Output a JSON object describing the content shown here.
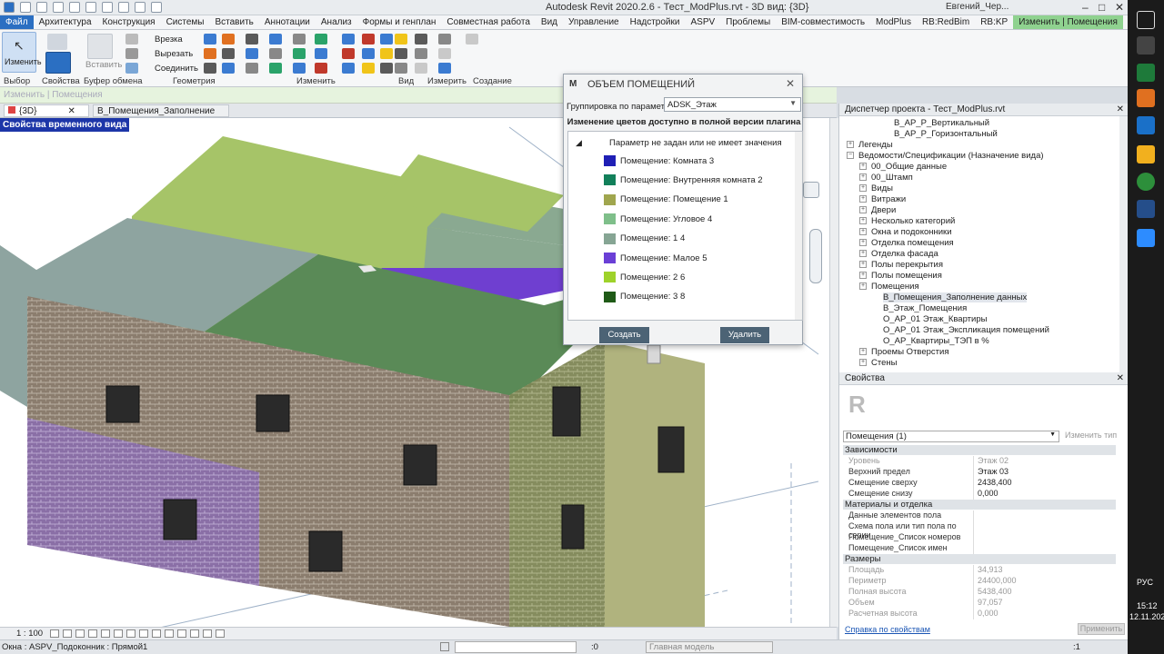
{
  "title": "Autodesk Revit 2020.2.6 - Тест_ModPlus.rvt - 3D вид: {3D}",
  "user": "Евгений_Чер...",
  "menu": [
    "Файл",
    "Архитектура",
    "Конструкция",
    "Системы",
    "Вставить",
    "Аннотации",
    "Анализ",
    "Формы и генплан",
    "Совместная работа",
    "Вид",
    "Управление",
    "Надстройки",
    "ASPV",
    "Проблемы",
    "BIM-совместимость",
    "ModPlus",
    "RB:RedBim",
    "RB:KP",
    "Изменить | Помещения"
  ],
  "ribbon": {
    "modify": "Изменить",
    "paste": "Вставить",
    "cut": "Врезка",
    "cut2": "Вырезать",
    "join": "Соединить",
    "groups": [
      "Выбор",
      "Свойства",
      "Буфер обмена",
      "Геометрия",
      "Изменить",
      "Вид",
      "Измерить",
      "Создание"
    ]
  },
  "context_line": "Изменить | Помещения",
  "view_tabs": [
    "{3D}",
    "В_Помещения_Заполнение данных"
  ],
  "viewport_label": "Свойства временного вида",
  "status": {
    "scale": "1 : 100",
    "hint": "Окна : ASPV_Подоконник : Прямой1",
    "count": ":0",
    "model": "Главная модель",
    "filter": ":1"
  },
  "dialog": {
    "title": "ОБЪЕМ ПОМЕЩЕНИЙ",
    "group_label": "Группировка по параметру:",
    "group_value": "ADSK_Этаж",
    "note": "Изменение цветов доступно в полной версии плагина",
    "tree_root": "Параметр не задан или не имеет значения",
    "items": [
      {
        "label": "Помещение: Комната 3",
        "color": "#1f1fb5"
      },
      {
        "label": "Помещение: Внутренняя комната 2",
        "color": "#12805a"
      },
      {
        "label": "Помещение: Помещение 1",
        "color": "#a0a64e"
      },
      {
        "label": "Помещение: Угловое 4",
        "color": "#7fbf8a"
      },
      {
        "label": "Помещение: 1 4",
        "color": "#86a594"
      },
      {
        "label": "Помещение: Малое 5",
        "color": "#6a3fd6"
      },
      {
        "label": "Помещение: 2 6",
        "color": "#9ed22a"
      },
      {
        "label": "Помещение: 3 8",
        "color": "#1f5a17"
      }
    ],
    "create": "Создать",
    "delete": "Удалить"
  },
  "browser": {
    "title": "Диспетчер проекта - Тест_ModPlus.rvt",
    "nodes": [
      {
        "label": "В_АР_Р_Вертикальный",
        "level": 3
      },
      {
        "label": "В_АР_Р_Горизонтальный",
        "level": 3
      },
      {
        "label": "Легенды",
        "level": 0
      },
      {
        "label": "Ведомости/Спецификации (Назначение вида)",
        "level": 0
      },
      {
        "label": "00_Общие данные",
        "level": 1
      },
      {
        "label": "00_Штамп",
        "level": 1
      },
      {
        "label": "Виды",
        "level": 1
      },
      {
        "label": "Витражи",
        "level": 1
      },
      {
        "label": "Двери",
        "level": 1
      },
      {
        "label": "Несколько категорий",
        "level": 1
      },
      {
        "label": "Окна и подоконники",
        "level": 1
      },
      {
        "label": "Отделка помещения",
        "level": 1
      },
      {
        "label": "Отделка фасада",
        "level": 1
      },
      {
        "label": "Полы перекрытия",
        "level": 1
      },
      {
        "label": "Полы помещения",
        "level": 1
      },
      {
        "label": "Помещения",
        "level": 1
      },
      {
        "label": "В_Помещения_Заполнение данных",
        "level": 2
      },
      {
        "label": "В_Этаж_Помещения",
        "level": 2
      },
      {
        "label": "О_АР_01 Этаж_Квартиры",
        "level": 2
      },
      {
        "label": "О_АР_01 Этаж_Экспликация помещений",
        "level": 2
      },
      {
        "label": "О_АР_Квартиры_ТЭП в %",
        "level": 2
      },
      {
        "label": "Проемы Отверстия",
        "level": 1
      },
      {
        "label": "Стены",
        "level": 1
      }
    ]
  },
  "props": {
    "title": "Свойства",
    "type_selector": "Помещения (1)",
    "edit_type": "Изменить тип",
    "sections": [
      "Зависимости",
      "Материалы и отделка",
      "Размеры"
    ],
    "rows1": [
      {
        "n": "Уровень",
        "v": "Этаж 02",
        "grey": true
      },
      {
        "n": "Верхний предел",
        "v": "Этаж 03",
        "grey": false
      },
      {
        "n": "Смещение сверху",
        "v": "2438,400",
        "grey": false
      },
      {
        "n": "Смещение снизу",
        "v": "0,000",
        "grey": false
      }
    ],
    "rows2": [
      {
        "n": "Данные элементов пола",
        "v": "",
        "grey": false
      },
      {
        "n": "Схема пола или тип пола по серии",
        "v": "",
        "grey": false
      },
      {
        "n": "Помещение_Список номеров",
        "v": "",
        "grey": false
      },
      {
        "n": "Помещение_Список имен",
        "v": "",
        "grey": false
      }
    ],
    "rows3": [
      {
        "n": "Площадь",
        "v": "34,913",
        "grey": true
      },
      {
        "n": "Периметр",
        "v": "24400,000",
        "grey": true
      },
      {
        "n": "Полная высота",
        "v": "5438,400",
        "grey": true
      },
      {
        "n": "Объем",
        "v": "97,057",
        "grey": true
      },
      {
        "n": "Расчетная высота",
        "v": "0,000",
        "grey": true
      }
    ],
    "help": "Справка по свойствам",
    "apply": "Применить"
  },
  "taskbar": {
    "lang": "РУС",
    "time": "15:12",
    "date": "12.11.2021"
  }
}
